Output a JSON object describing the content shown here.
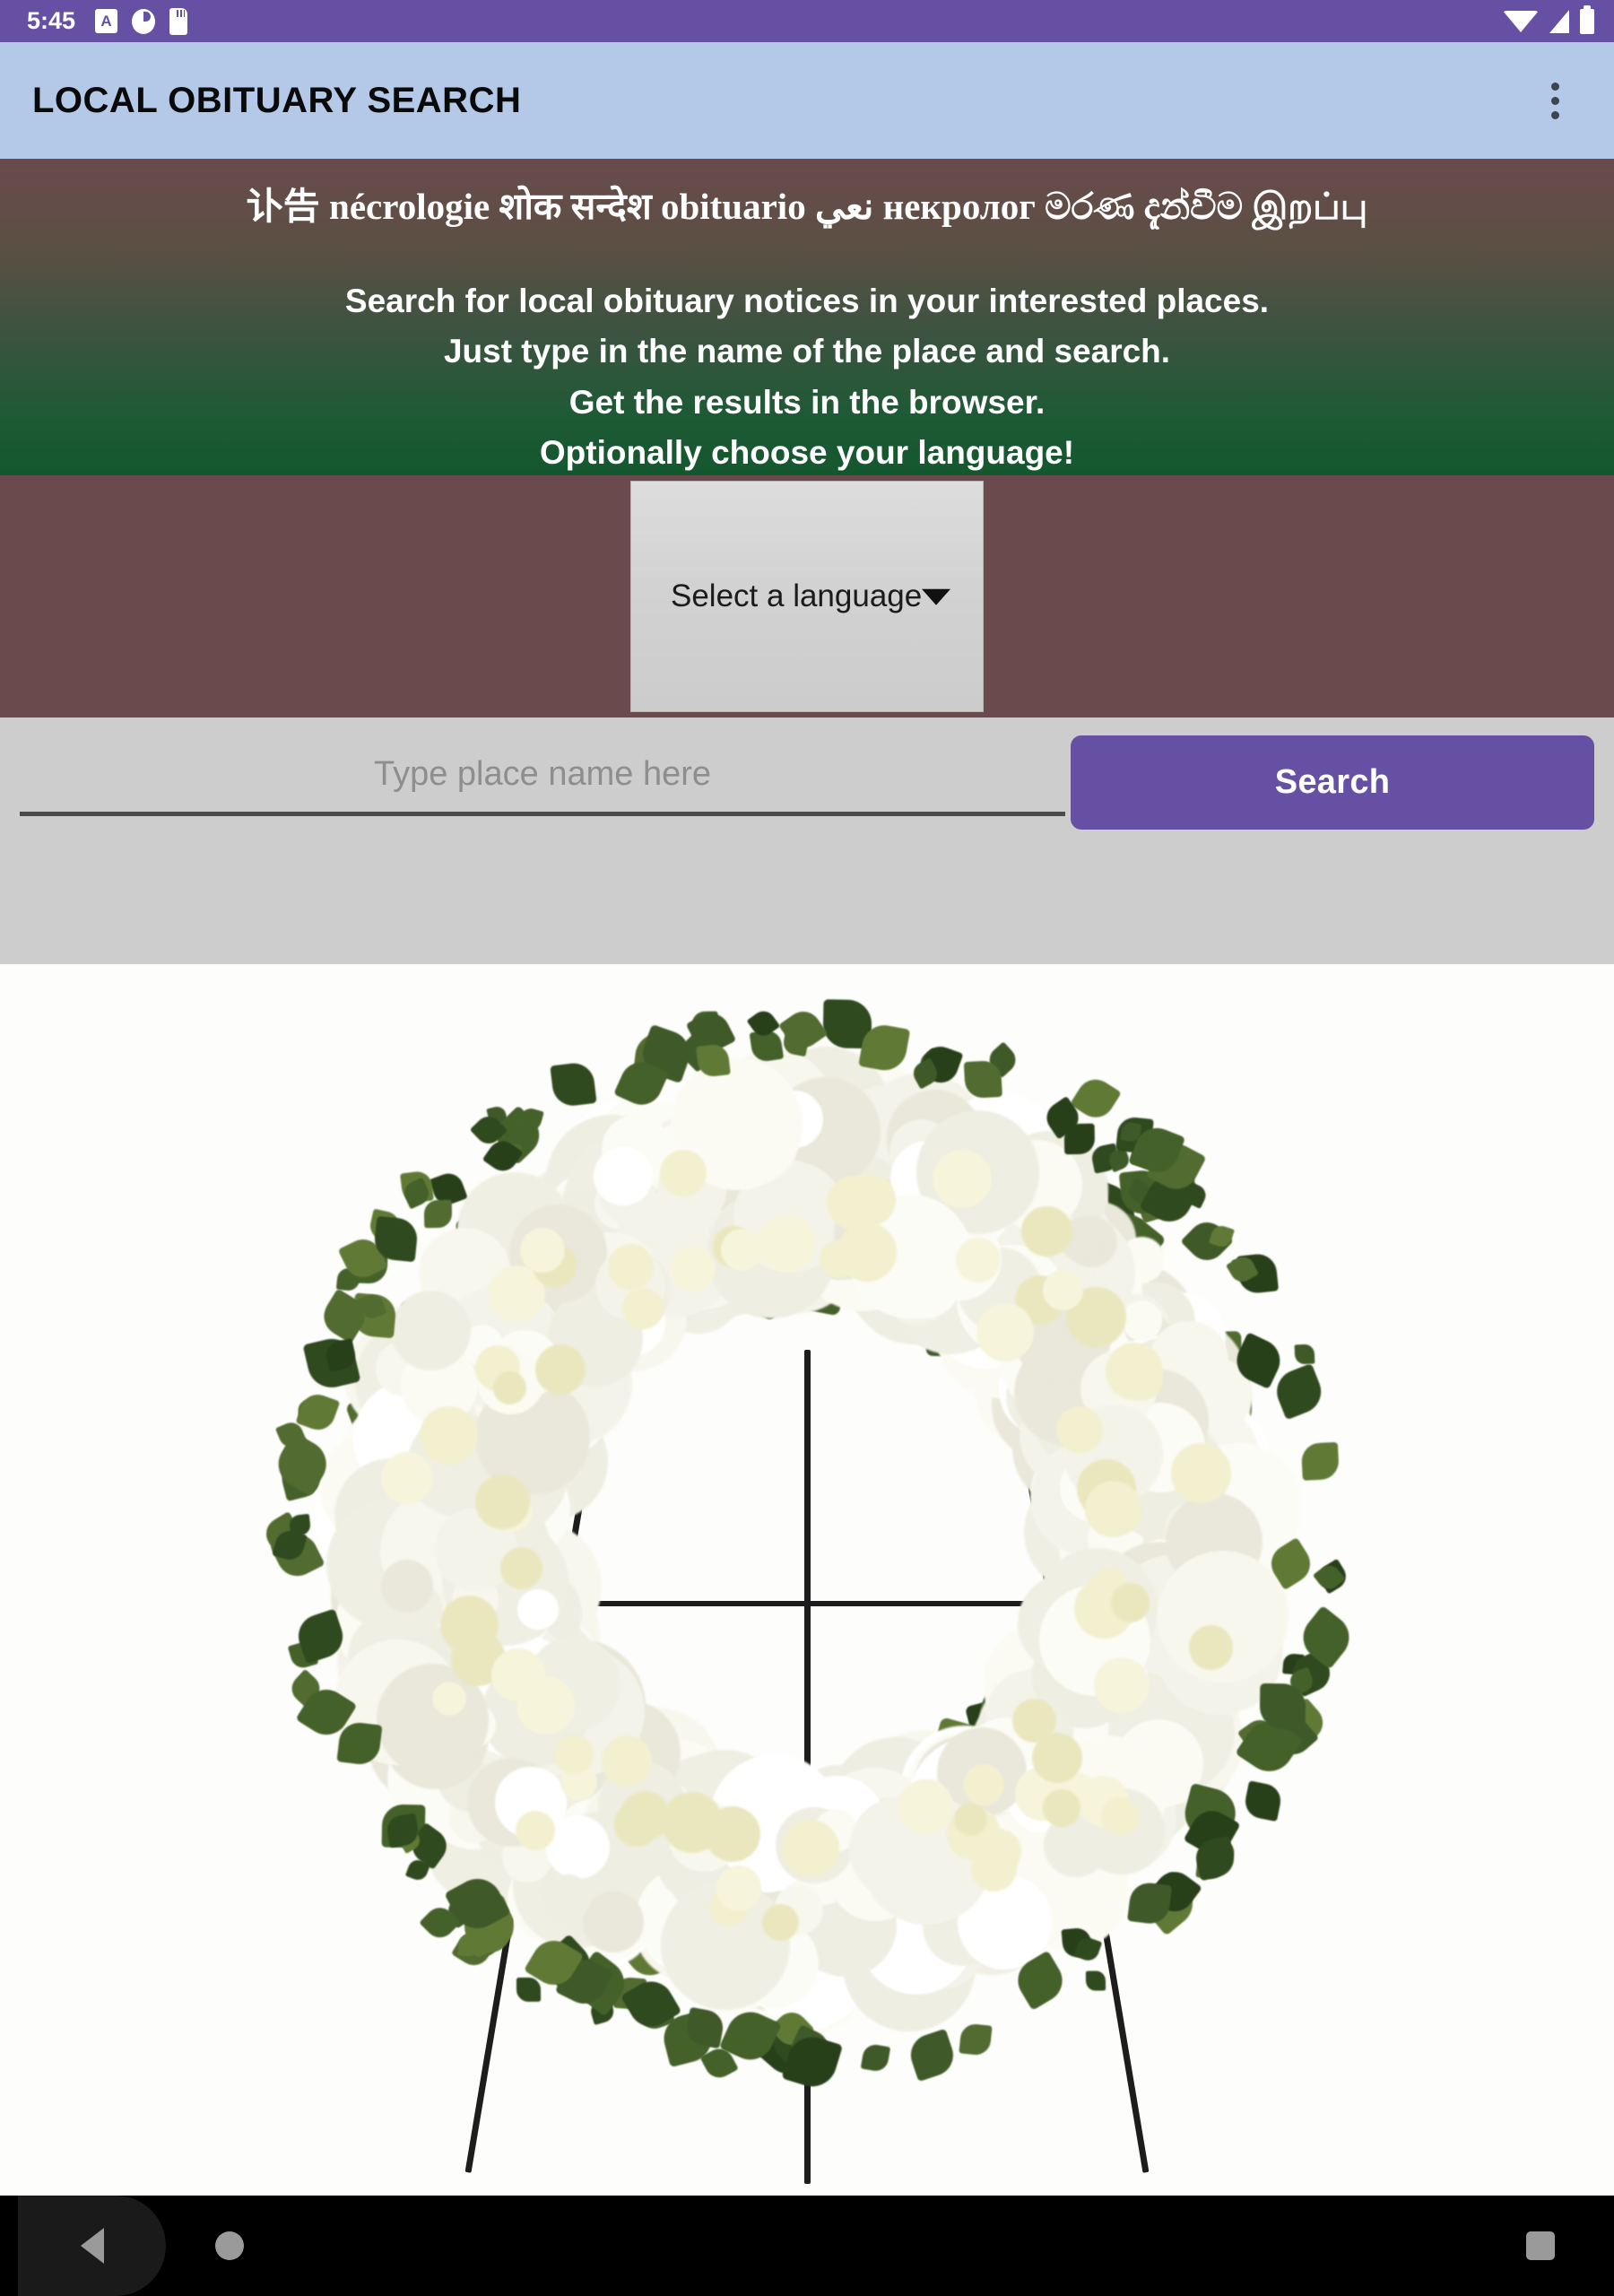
{
  "status_bar": {
    "clock": "5:45",
    "icons_left": [
      "alarm-icon",
      "do-not-disturb-icon",
      "sd-card-icon"
    ],
    "icons_right": [
      "wifi-icon",
      "cellular-signal-icon",
      "battery-icon"
    ],
    "background_color": "#6650a4"
  },
  "app_bar": {
    "title": "LOCAL OBITUARY SEARCH",
    "overflow_menu_label": "More options",
    "background_color": "#b4c9e7",
    "title_color": "#0a0a0a"
  },
  "hero": {
    "multilingual_title": "讣告 nécrologie शोक सन्देश obituario نعي некролог මරණ දැන්වීම இறப்பு",
    "description_lines": [
      "Search for local obituary notices in your interested places.",
      "Just type in the name of the place and search.",
      "Get the results in the browser.",
      "Optionally choose your language!"
    ],
    "gradient_from": "#6a4a4c",
    "gradient_to": "#14572e"
  },
  "language_picker": {
    "selected_label": "Select a language",
    "caret_icon": "chevron-down-icon",
    "band_background": "#6a4a4c",
    "control_background": "#d4d4d4"
  },
  "search": {
    "placeholder": "Type place name here",
    "value": "",
    "button_label": "Search",
    "button_color": "#6650a4",
    "band_background": "#cdcdcd"
  },
  "photo": {
    "alt": "White funeral wreath of lilies roses and chrysanthemums on a black wire easel",
    "background_color": "#fdfdfb"
  },
  "nav_bar": {
    "back_label": "Back",
    "home_label": "Home",
    "recents_label": "Recent apps",
    "background_color": "#000000"
  }
}
